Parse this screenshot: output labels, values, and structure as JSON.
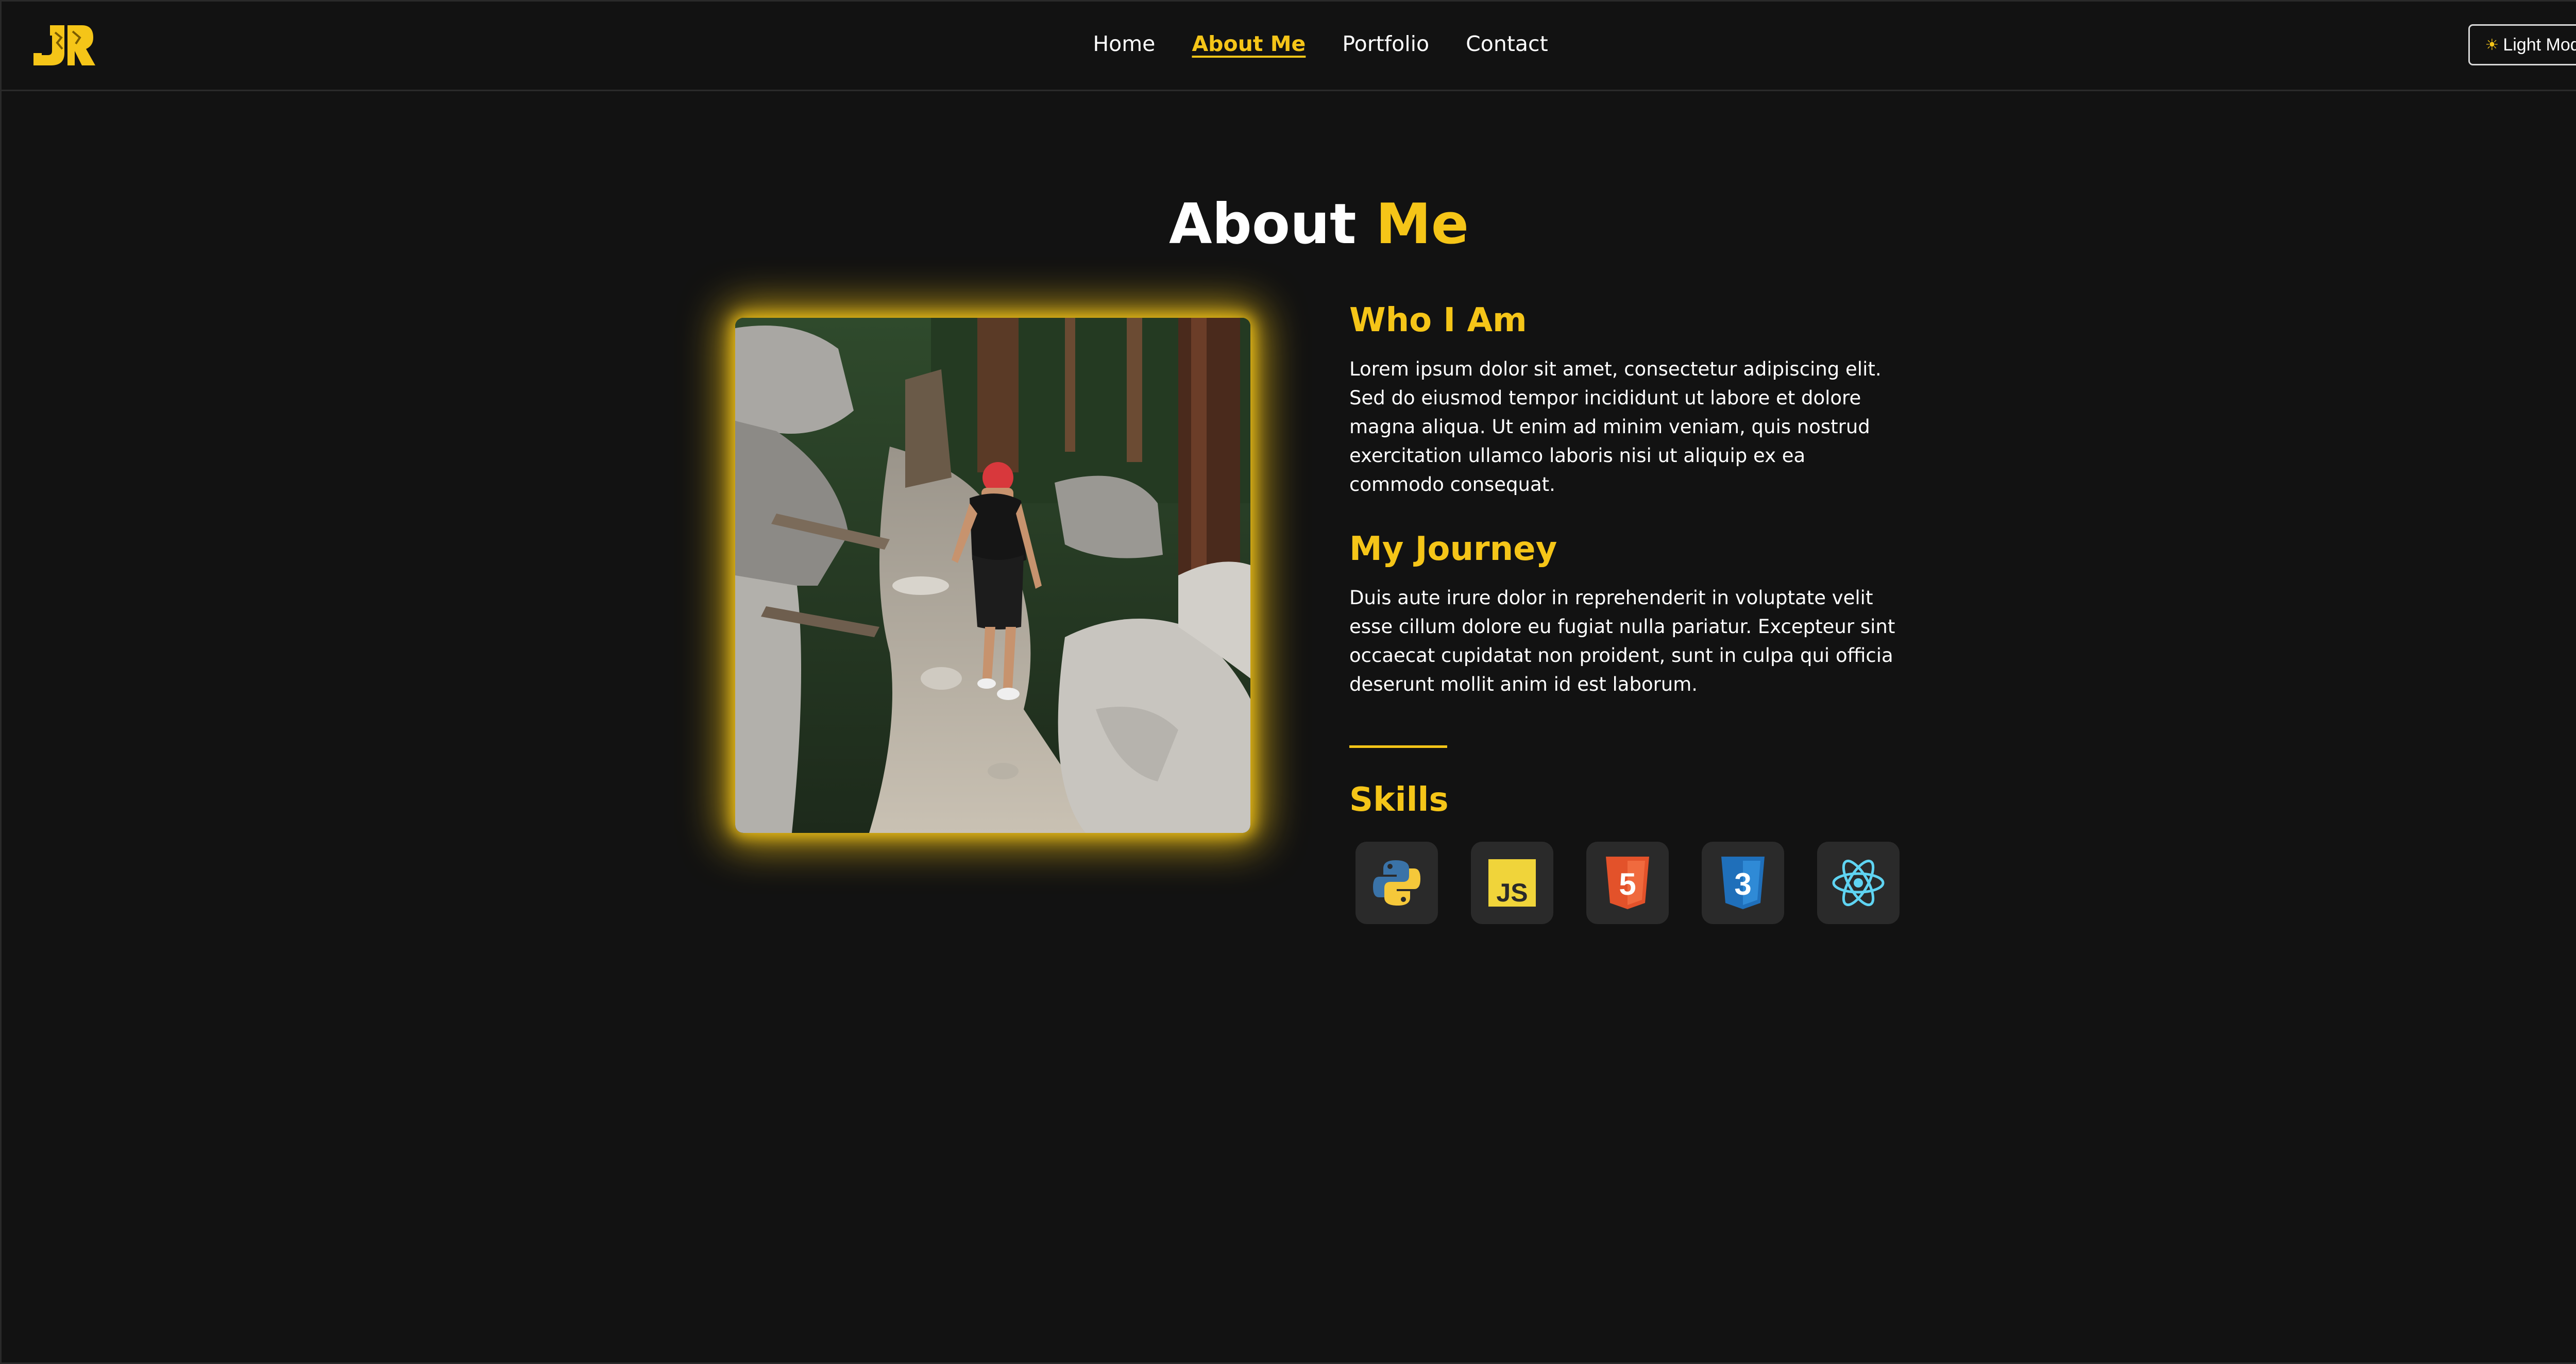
{
  "header": {
    "nav": [
      {
        "label": "Home",
        "active": false
      },
      {
        "label": "About Me",
        "active": true
      },
      {
        "label": "Portfolio",
        "active": false
      },
      {
        "label": "Contact",
        "active": false
      }
    ],
    "theme_toggle": {
      "icon": "sun-icon",
      "icon_glyph": "☀",
      "label": "Light Mode"
    }
  },
  "title": {
    "part1": "About ",
    "part2": "Me"
  },
  "sections": [
    {
      "heading": "Who I Am",
      "body": "Lorem ipsum dolor sit amet, consectetur adipiscing elit. Sed do eiusmod tempor incididunt ut labore et dolore magna aliqua. Ut enim ad minim veniam, quis nostrud exercitation ullamco laboris nisi ut aliquip ex ea commodo consequat."
    },
    {
      "heading": "My Journey",
      "body": "Duis aute irure dolor in reprehenderit in voluptate velit esse cillum dolore eu fugiat nulla pariatur. Excepteur sint occaecat cupidatat non proident, sunt in culpa qui officia deserunt mollit anim id est laborum."
    }
  ],
  "skills": {
    "heading": "Skills",
    "items": [
      {
        "icon": "python-icon"
      },
      {
        "icon": "javascript-icon",
        "label": "JS"
      },
      {
        "icon": "html5-icon",
        "label": "5"
      },
      {
        "icon": "css3-icon",
        "label": "3"
      },
      {
        "icon": "react-icon"
      }
    ]
  },
  "colors": {
    "accent": "#f5c518",
    "background": "#121212",
    "tile": "#2a2a2a"
  }
}
